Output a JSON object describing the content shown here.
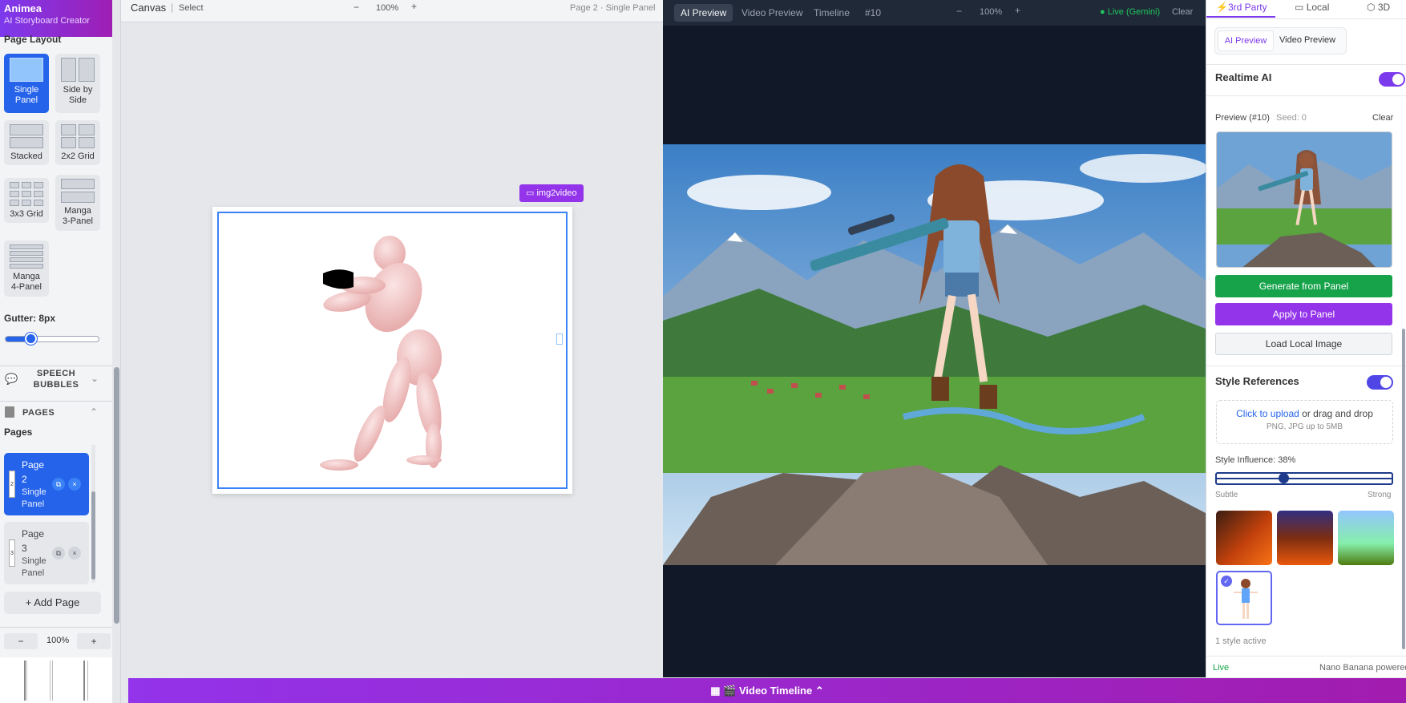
{
  "app": {
    "title": "Animea",
    "subtitle": "AI Storyboard Creator"
  },
  "sidebar": {
    "layout_title": "Page Layout",
    "layouts": [
      {
        "label1": "Single",
        "label2": "Panel",
        "selected": true
      },
      {
        "label1": "Side by",
        "label2": "Side"
      },
      {
        "label1": "Stacked",
        "label2": ""
      },
      {
        "label1": "2x2 Grid",
        "label2": ""
      },
      {
        "label1": "3x3 Grid",
        "label2": ""
      },
      {
        "label1": "Manga",
        "label2": "3-Panel"
      },
      {
        "label1": "Manga",
        "label2": "4-Panel"
      }
    ],
    "gutter_label": "Gutter: 8px",
    "gutter_value": 8,
    "gutter_max": 30,
    "speech_bubbles_label1": "SPEECH",
    "speech_bubbles_label2": "BUBBLES",
    "pages_header": "PAGES",
    "pages_title": "Pages",
    "pages": [
      {
        "name1": "Page",
        "name2": "2",
        "layout1": "Single",
        "layout2": "Panel",
        "num": "2",
        "selected": true
      },
      {
        "name1": "Page",
        "name2": "3",
        "layout1": "Single",
        "layout2": "Panel",
        "num": "3",
        "selected": false
      }
    ],
    "add_page": "+ Add Page",
    "zoom": "100%",
    "zoom_minus": "−",
    "zoom_plus": "+"
  },
  "canvas": {
    "title": "Canvas",
    "mode": "Select",
    "zoom": "100%",
    "zoom_minus": "−",
    "zoom_plus": "+",
    "page_info": "Page 2 · Single Panel",
    "img2video": "img2video"
  },
  "preview": {
    "tabs": [
      "AI Preview",
      "Video Preview",
      "Timeline"
    ],
    "active_tab": "AI Preview",
    "frame_id": "#10",
    "zoom": "100%",
    "zoom_minus": "−",
    "zoom_plus": "+",
    "live": "Live (Gemini)",
    "clear": "Clear"
  },
  "right": {
    "top_tabs": [
      "3rd Party",
      "Local",
      "3D"
    ],
    "sub_tabs": [
      "AI Preview",
      "Video Preview"
    ],
    "realtime_title": "Realtime AI",
    "preview_label": "Preview (#10)",
    "seed": "Seed: 0",
    "clear": "Clear",
    "generate_btn": "Generate from Panel",
    "apply_btn": "Apply to Panel",
    "load_btn": "Load Local Image",
    "style_refs_title": "Style References",
    "upload_link": "Click to upload",
    "upload_rest": " or drag and drop",
    "upload_hint": "PNG, JPG up to 5MB",
    "influence_label": "Style Influence: 38%",
    "influence_value": 0.38,
    "subtle": "Subtle",
    "strong": "Strong",
    "active_count": "1 style active",
    "footer_live": "Live",
    "footer_powered": "Nano Banana powered"
  },
  "bottom": {
    "label": "🎬 Video Timeline"
  },
  "colors": {
    "accent": "#7c3aed",
    "blue": "#2563eb",
    "green": "#16a34a"
  }
}
